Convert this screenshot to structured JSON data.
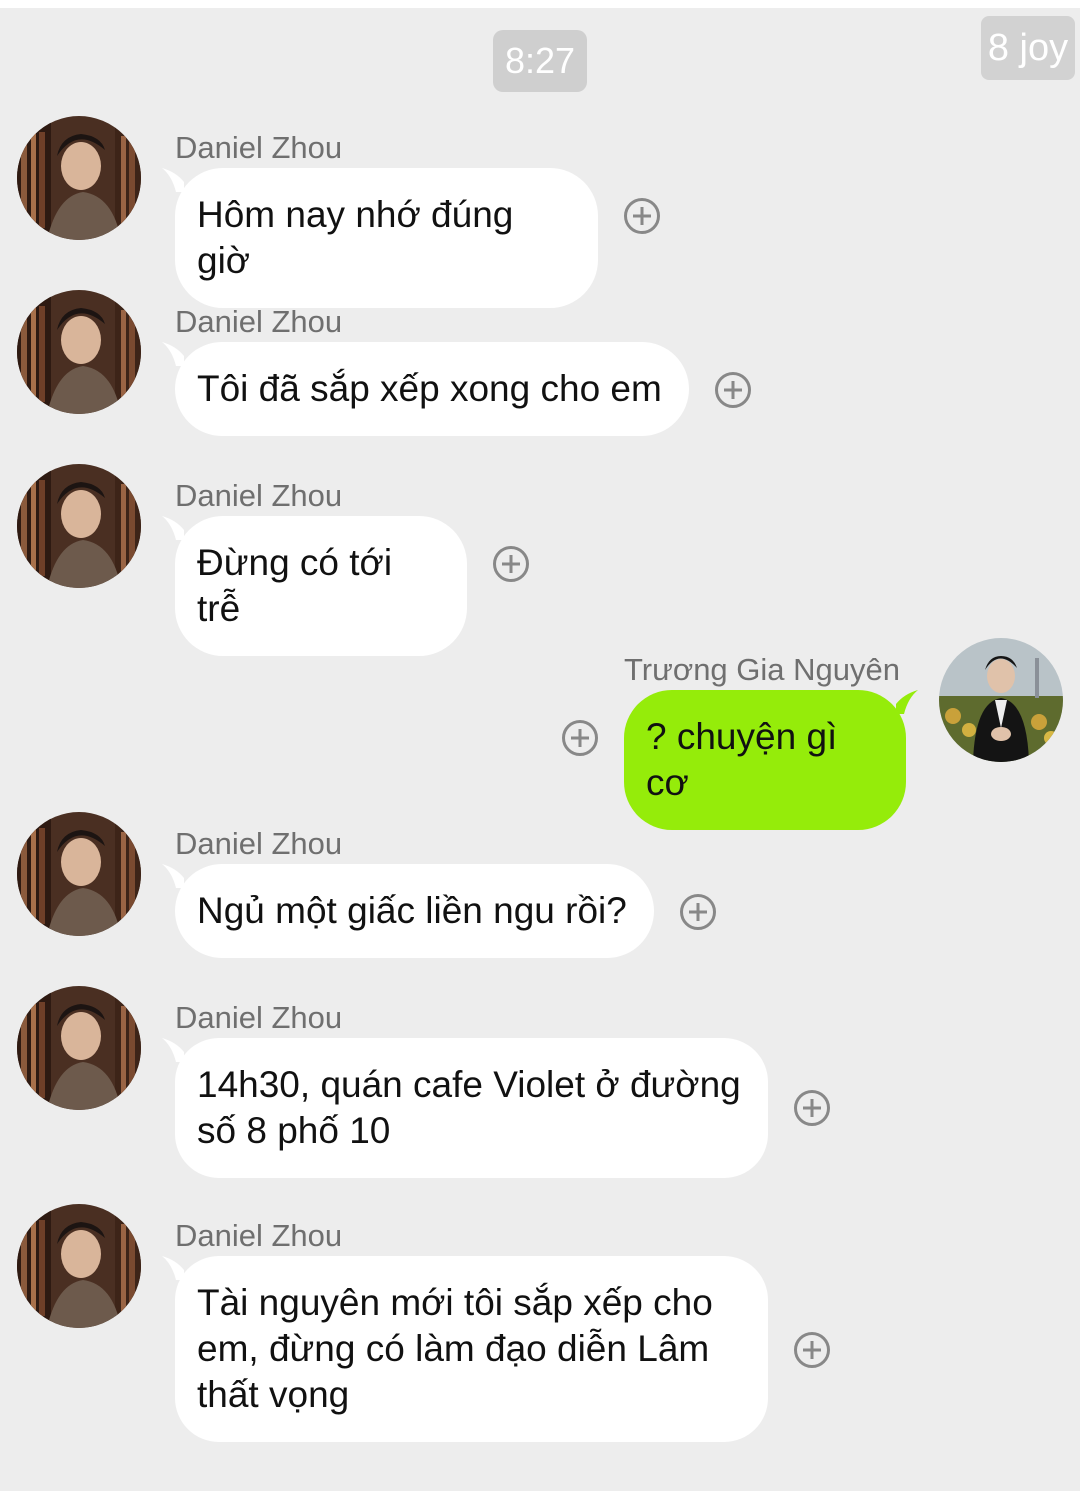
{
  "header": {
    "time": "8:27",
    "watermark": "8 joy"
  },
  "chat": {
    "messages": [
      {
        "sender": "Daniel Zhou",
        "text": "Hôm nay nhớ đúng giờ",
        "direction": "incoming"
      },
      {
        "sender": "Daniel Zhou",
        "text": "Tôi đã sắp xếp xong cho em",
        "direction": "incoming"
      },
      {
        "sender": "Daniel Zhou",
        "text": "Đừng có tới trễ",
        "direction": "incoming"
      },
      {
        "sender": "Trương Gia Nguyên",
        "text": "? chuyện gì cơ",
        "direction": "outgoing"
      },
      {
        "sender": "Daniel Zhou",
        "text": "Ngủ một giấc liền ngu rồi?",
        "direction": "incoming"
      },
      {
        "sender": "Daniel Zhou",
        "text": "14h30, quán cafe Violet ở đường số 8 phố 10",
        "direction": "incoming"
      },
      {
        "sender": "Daniel Zhou",
        "text": "Tài nguyên mới tôi sắp xếp cho em, đừng có làm đạo diễn Lâm thất vọng",
        "direction": "incoming"
      }
    ]
  },
  "icons": {
    "message_action": "plus-circle-icon",
    "incoming_avatar": "avatar-daniel-zhou",
    "outgoing_avatar": "avatar-truong-gia-nguyen"
  },
  "colors": {
    "background": "#ededed",
    "incoming_bubble": "#ffffff",
    "outgoing_bubble": "#95ec0a",
    "sender_name": "#6f6f6f",
    "time_pill": "#cfcfcf"
  }
}
